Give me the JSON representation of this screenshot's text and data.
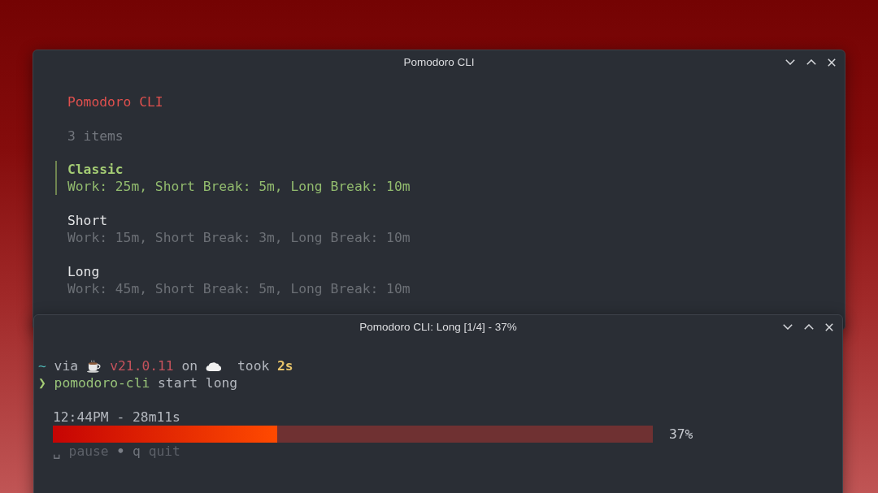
{
  "list_window": {
    "title": "Pomodoro CLI",
    "heading": "Pomodoro CLI",
    "count": "3 items",
    "items": [
      {
        "name": "Classic",
        "description": "Work: 25m, Short Break: 5m, Long Break: 10m",
        "selected": true
      },
      {
        "name": "Short",
        "description": "Work: 15m, Short Break: 3m, Long Break: 10m",
        "selected": false
      },
      {
        "name": "Long",
        "description": "Work: 45m, Short Break: 5m, Long Break: 10m",
        "selected": false
      }
    ]
  },
  "timer_window": {
    "title": "Pomodoro CLI: Long [1/4] - 37%",
    "prompt": {
      "directory": "~",
      "via": "via",
      "version": "v21.0.11",
      "on": "on",
      "took": "took",
      "duration": "2s"
    },
    "command": {
      "symbol": "❯",
      "program": "pomodoro-cli",
      "args": "start long"
    },
    "timer": "12:44PM - 28m11s",
    "progress": {
      "level": 0.374,
      "reading": "37%"
    },
    "help": [
      {
        "key": "␣",
        "action": "pause"
      },
      {
        "key": "q",
        "action": "quit"
      }
    ],
    "help_separator": "•"
  }
}
